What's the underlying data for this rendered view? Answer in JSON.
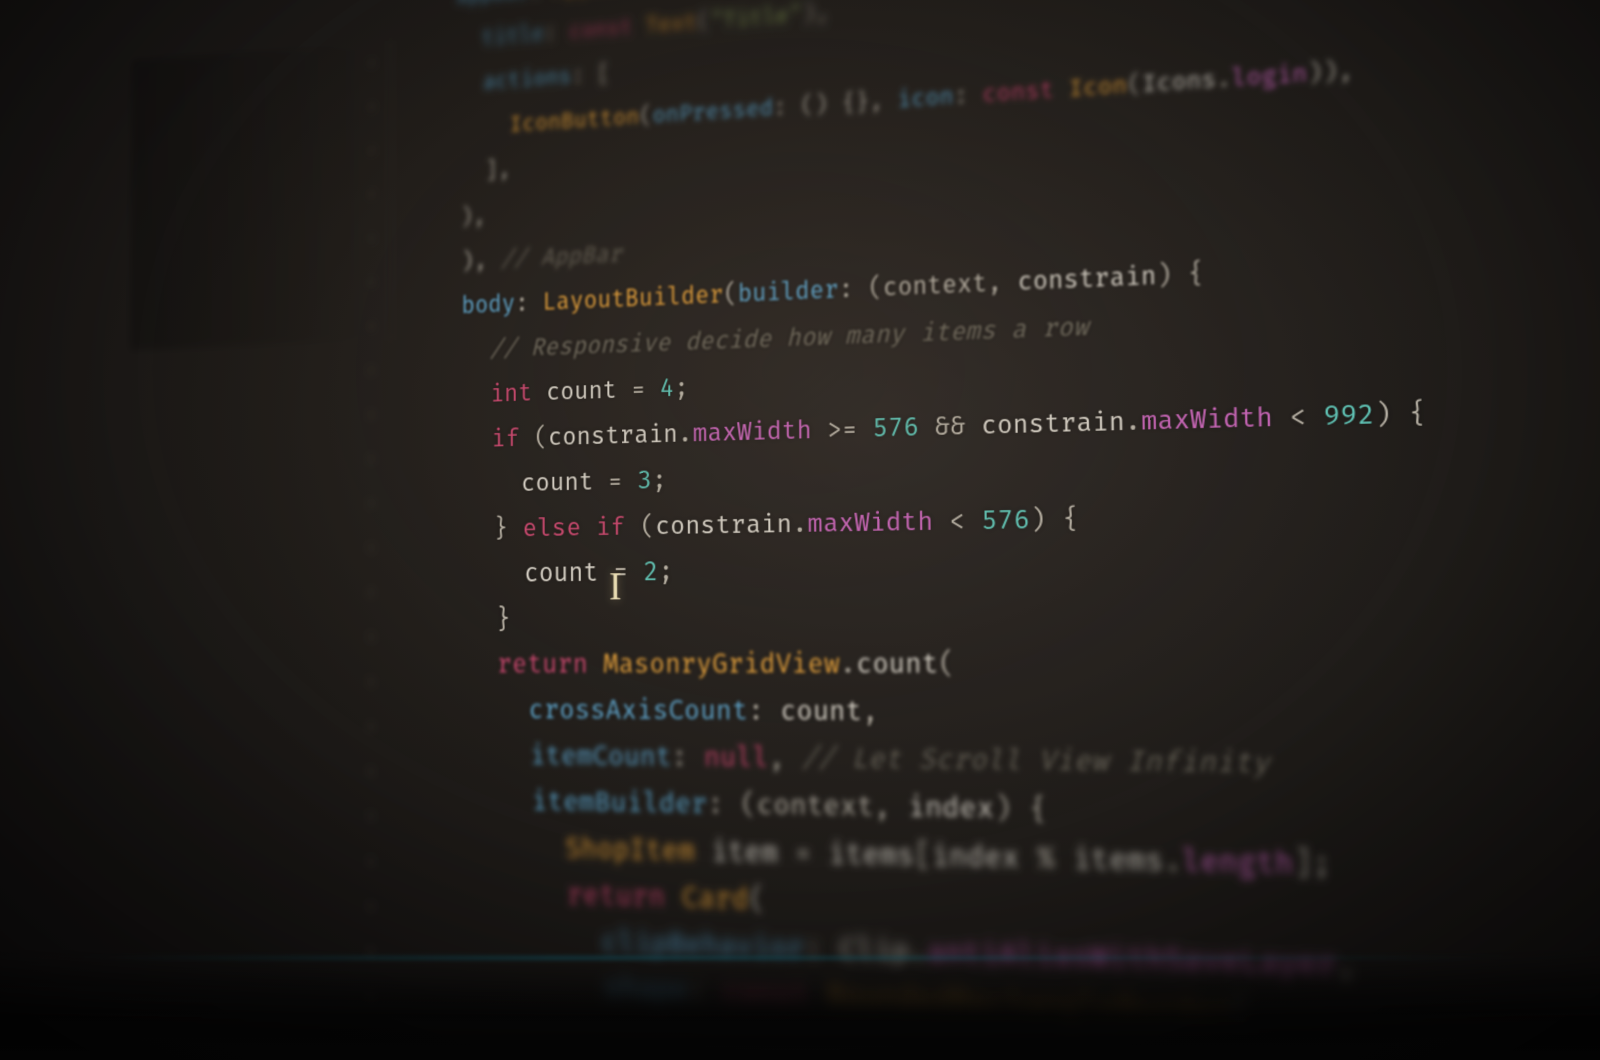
{
  "editor": {
    "language": "dart",
    "theme": "dark-warm",
    "cursor_shape": "I-beam",
    "lines": [
      {
        "i": 1,
        "indent": 2,
        "blur": "b5",
        "tokens": [
          [
            "prop",
            "appBar"
          ],
          [
            "punc",
            ": "
          ],
          [
            "orange",
            "AppBar"
          ],
          [
            "punc",
            "("
          ]
        ]
      },
      {
        "i": 2,
        "indent": 3,
        "blur": "b5",
        "tokens": [
          [
            "prop",
            "title"
          ],
          [
            "punc",
            ": "
          ],
          [
            "kw",
            "const"
          ],
          [
            "punc",
            " "
          ],
          [
            "orange",
            "Text"
          ],
          [
            "punc",
            "("
          ],
          [
            "str",
            "\"Title\""
          ],
          [
            "punc",
            "),"
          ]
        ]
      },
      {
        "i": 3,
        "indent": 3,
        "blur": "b4",
        "tokens": [
          [
            "prop",
            "actions"
          ],
          [
            "punc",
            ": ["
          ]
        ]
      },
      {
        "i": 4,
        "indent": 4,
        "blur": "b3",
        "tokens": [
          [
            "orange",
            "IconButton"
          ],
          [
            "punc",
            "("
          ],
          [
            "prop",
            "onPressed"
          ],
          [
            "punc",
            ": "
          ],
          [
            "punc",
            "() {}"
          ],
          [
            "punc",
            ", "
          ],
          [
            "prop",
            "icon"
          ],
          [
            "punc",
            ": "
          ],
          [
            "kw",
            "const"
          ],
          [
            "punc",
            " "
          ],
          [
            "orange",
            "Icon"
          ],
          [
            "punc",
            "("
          ],
          [
            "ident",
            "Icons"
          ],
          [
            "punc",
            "."
          ],
          [
            "mag",
            "login"
          ],
          [
            "punc",
            ")),"
          ]
        ]
      },
      {
        "i": 5,
        "indent": 3,
        "blur": "b3",
        "tokens": [
          [
            "punc",
            "],"
          ]
        ]
      },
      {
        "i": 6,
        "indent": 2,
        "blur": "b3",
        "tokens": [
          [
            "punc",
            "),"
          ]
        ]
      },
      {
        "i": 7,
        "indent": 2,
        "blur": "b2",
        "tokens": [
          [
            "punc",
            "), "
          ],
          [
            "cmnt",
            "// AppBar"
          ]
        ]
      },
      {
        "i": 8,
        "indent": 2,
        "blur": "b1",
        "tokens": [
          [
            "prop",
            "body"
          ],
          [
            "punc",
            ": "
          ],
          [
            "orange",
            "LayoutBuilder"
          ],
          [
            "punc",
            "("
          ],
          [
            "prop",
            "builder"
          ],
          [
            "punc",
            ": (context"
          ],
          [
            "punc",
            ", "
          ],
          [
            "ident",
            "constrain"
          ],
          [
            "punc",
            ") {"
          ]
        ]
      },
      {
        "i": 9,
        "indent": 3,
        "blur": "b1",
        "tokens": [
          [
            "cmnt",
            "// Responsive decide how many items a row"
          ]
        ]
      },
      {
        "i": 10,
        "indent": 3,
        "blur": "b0",
        "tokens": [
          [
            "kw",
            "int"
          ],
          [
            "punc",
            " "
          ],
          [
            "ident",
            "count"
          ],
          [
            "punc",
            " = "
          ],
          [
            "num",
            "4"
          ],
          [
            "punc",
            ";"
          ]
        ]
      },
      {
        "i": 11,
        "indent": 3,
        "blur": "b0",
        "tokens": [
          [
            "kw",
            "if"
          ],
          [
            "punc",
            " ("
          ],
          [
            "ident",
            "constrain"
          ],
          [
            "punc",
            "."
          ],
          [
            "mag",
            "maxWidth"
          ],
          [
            "punc",
            " >= "
          ],
          [
            "num",
            "576"
          ],
          [
            "punc",
            " && "
          ],
          [
            "ident",
            "constrain"
          ],
          [
            "punc",
            "."
          ],
          [
            "mag",
            "maxWidth"
          ],
          [
            "punc",
            " < "
          ],
          [
            "num",
            "992"
          ],
          [
            "punc",
            ") {"
          ]
        ]
      },
      {
        "i": 12,
        "indent": 4,
        "blur": "b0",
        "tokens": [
          [
            "ident",
            "count"
          ],
          [
            "punc",
            " = "
          ],
          [
            "num",
            "3"
          ],
          [
            "punc",
            ";"
          ]
        ]
      },
      {
        "i": 13,
        "indent": 3,
        "blur": "b0",
        "tokens": [
          [
            "punc",
            "} "
          ],
          [
            "kw",
            "else if"
          ],
          [
            "punc",
            " ("
          ],
          [
            "ident",
            "constrain"
          ],
          [
            "punc",
            "."
          ],
          [
            "mag",
            "maxWidth"
          ],
          [
            "punc",
            " < "
          ],
          [
            "num",
            "576"
          ],
          [
            "punc",
            ") {"
          ]
        ]
      },
      {
        "i": 14,
        "indent": 4,
        "blur": "b0",
        "tokens": [
          [
            "ident",
            "count"
          ],
          [
            "punc",
            " = "
          ],
          [
            "num",
            "2"
          ],
          [
            "punc",
            ";"
          ]
        ]
      },
      {
        "i": 15,
        "indent": 3,
        "blur": "b0",
        "tokens": [
          [
            "punc",
            "}"
          ]
        ]
      },
      {
        "i": 16,
        "indent": 3,
        "blur": "bb1",
        "tokens": [
          [
            "kw2",
            "return"
          ],
          [
            "punc",
            " "
          ],
          [
            "orange",
            "MasonryGridView"
          ],
          [
            "punc",
            "."
          ],
          [
            "ident",
            "count"
          ],
          [
            "punc",
            "("
          ]
        ]
      },
      {
        "i": 17,
        "indent": 4,
        "blur": "bb1",
        "tokens": [
          [
            "prop",
            "crossAxisCount"
          ],
          [
            "punc",
            ": "
          ],
          [
            "ident",
            "count"
          ],
          [
            "punc",
            ","
          ]
        ]
      },
      {
        "i": 18,
        "indent": 4,
        "blur": "bb2",
        "tokens": [
          [
            "prop",
            "itemCount"
          ],
          [
            "punc",
            ": "
          ],
          [
            "kw",
            "null"
          ],
          [
            "punc",
            ", "
          ],
          [
            "cmnt",
            "// Let Scroll View Infinity"
          ]
        ]
      },
      {
        "i": 19,
        "indent": 4,
        "blur": "bb2",
        "tokens": [
          [
            "prop",
            "itemBuilder"
          ],
          [
            "punc",
            ": (context"
          ],
          [
            "punc",
            ", "
          ],
          [
            "ident",
            "index"
          ],
          [
            "punc",
            ") {"
          ]
        ]
      },
      {
        "i": 20,
        "indent": 5,
        "blur": "bb3",
        "tokens": [
          [
            "orange",
            "ShopItem"
          ],
          [
            "punc",
            " "
          ],
          [
            "ident",
            "item"
          ],
          [
            "punc",
            " = "
          ],
          [
            "ident",
            "items"
          ],
          [
            "punc",
            "["
          ],
          [
            "ident",
            "index"
          ],
          [
            "punc",
            " % "
          ],
          [
            "ident",
            "items"
          ],
          [
            "punc",
            "."
          ],
          [
            "mag",
            "length"
          ],
          [
            "punc",
            "];"
          ]
        ]
      },
      {
        "i": 21,
        "indent": 5,
        "blur": "bb3",
        "tokens": [
          [
            "kw2",
            "return"
          ],
          [
            "punc",
            " "
          ],
          [
            "orange",
            "Card"
          ],
          [
            "punc",
            "("
          ]
        ]
      },
      {
        "i": 22,
        "indent": 6,
        "blur": "bb4",
        "tokens": [
          [
            "prop",
            "clipBehavior"
          ],
          [
            "punc",
            ": "
          ],
          [
            "ident",
            "Clip"
          ],
          [
            "punc",
            "."
          ],
          [
            "mag",
            "antiAliasWithSaveLayer"
          ],
          [
            "punc",
            ","
          ]
        ]
      },
      {
        "i": 23,
        "indent": 6,
        "blur": "bb5",
        "tokens": [
          [
            "prop",
            "shape"
          ],
          [
            "punc",
            ": "
          ],
          [
            "kw",
            "const"
          ],
          [
            "punc",
            " "
          ],
          [
            "orange",
            "RoundedRectangleBorder"
          ],
          [
            "punc",
            "("
          ]
        ]
      }
    ]
  }
}
